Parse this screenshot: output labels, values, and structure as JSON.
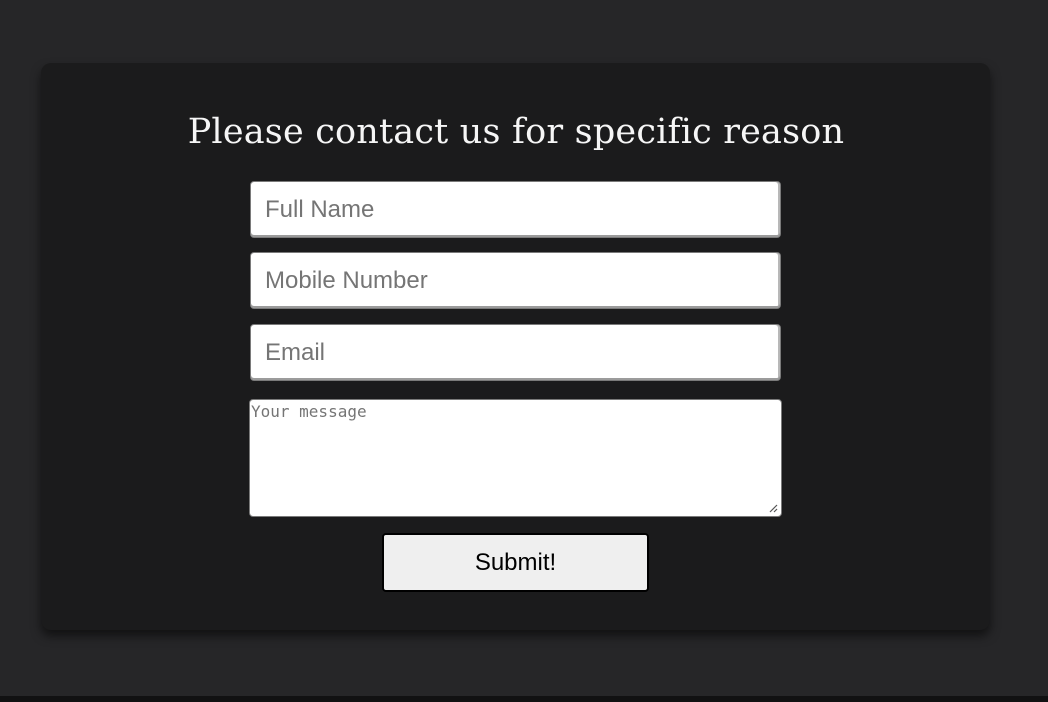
{
  "contact_form": {
    "title": "Please contact us for specific reason",
    "full_name_placeholder": "Full Name",
    "mobile_placeholder": "Mobile Number",
    "email_placeholder": "Email",
    "message_placeholder": "Your message",
    "submit_label": "Submit!"
  },
  "colors": {
    "page_background": "#262628",
    "card_background": "#1b1b1c",
    "title_text": "#f6f6f6",
    "button_background": "#efefef"
  },
  "icons": {
    "textarea_resize": "resize-grip-icon"
  }
}
